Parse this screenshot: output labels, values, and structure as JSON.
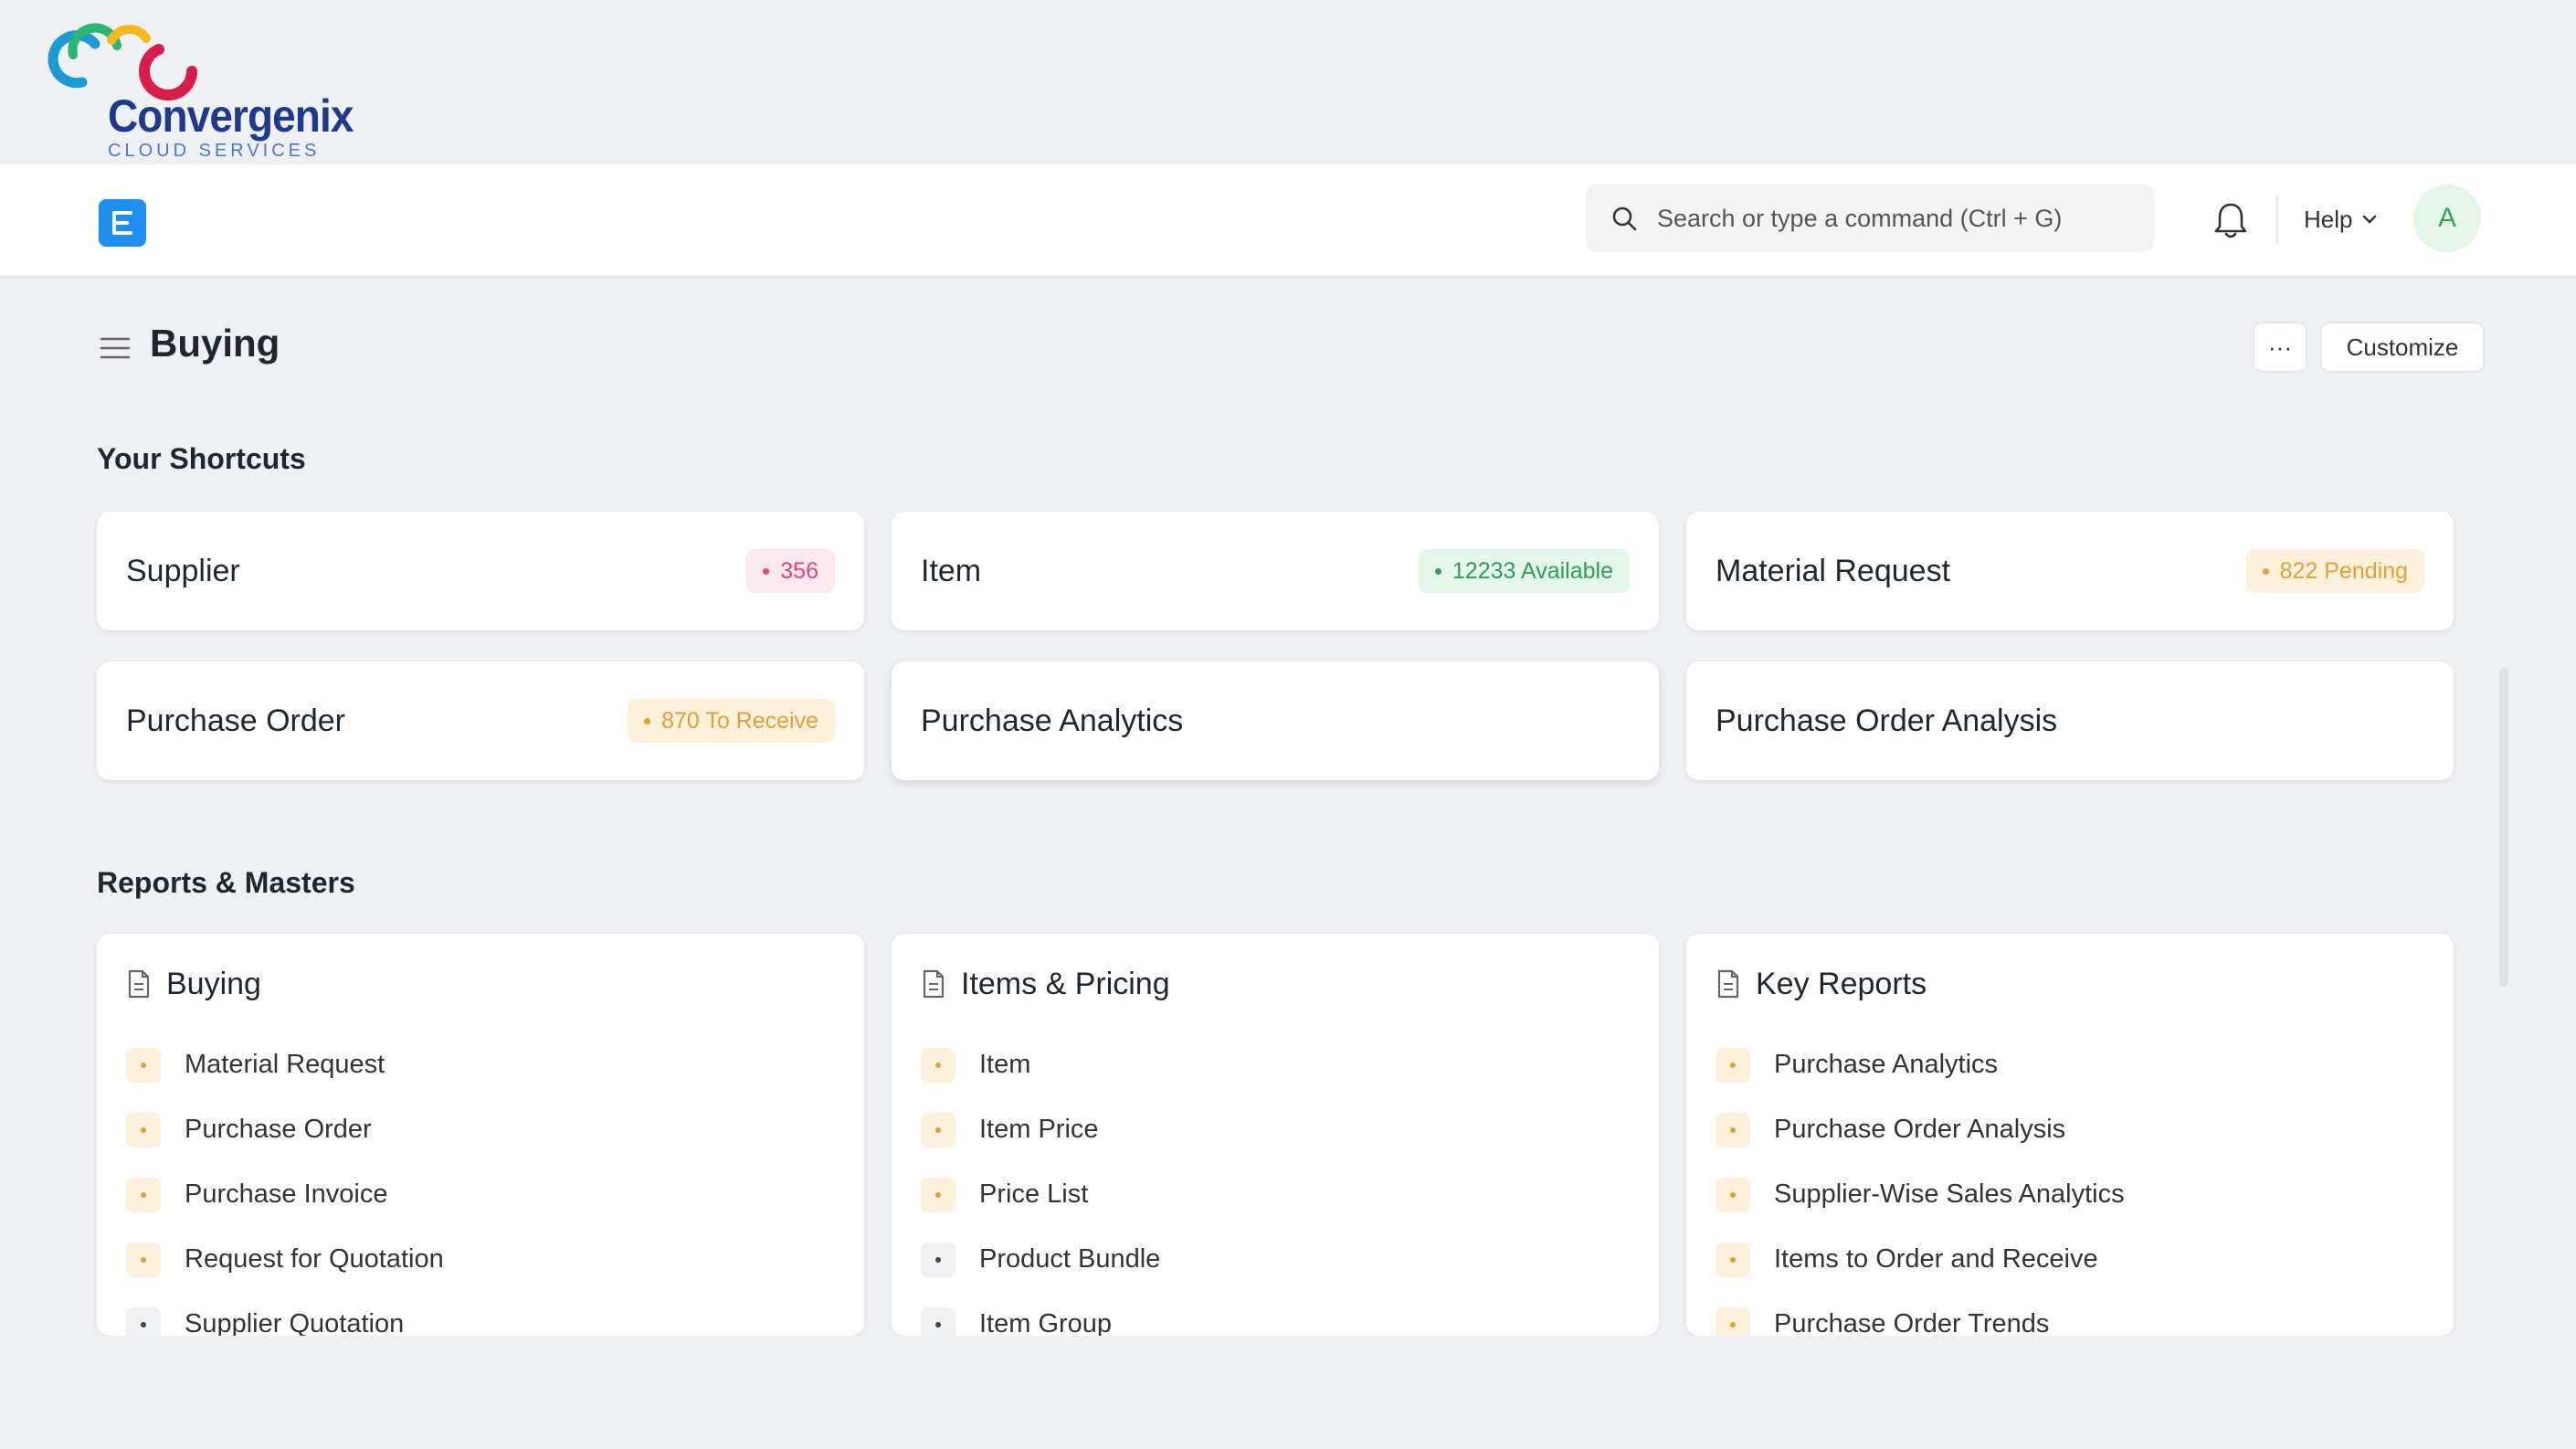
{
  "brand": {
    "name": "Convergenix",
    "tagline": "CLOUD SERVICES"
  },
  "navbar": {
    "app_logo_letter": "E",
    "search_placeholder": "Search or type a command (Ctrl + G)",
    "help_label": "Help",
    "avatar_initial": "A"
  },
  "page": {
    "title": "Buying",
    "more_label": "···",
    "customize_label": "Customize"
  },
  "shortcuts": {
    "title": "Your Shortcuts",
    "items": [
      {
        "label": "Supplier",
        "badge": "356"
      },
      {
        "label": "Item",
        "badge": "12233 Available"
      },
      {
        "label": "Material Request",
        "badge": "822 Pending"
      },
      {
        "label": "Purchase Order",
        "badge": "870 To Receive"
      },
      {
        "label": "Purchase Analytics"
      },
      {
        "label": "Purchase Order Analysis"
      }
    ]
  },
  "reports": {
    "title": "Reports & Masters",
    "cards": [
      {
        "title": "Buying",
        "items": [
          "Material Request",
          "Purchase Order",
          "Purchase Invoice",
          "Request for Quotation",
          "Supplier Quotation"
        ]
      },
      {
        "title": "Items & Pricing",
        "items": [
          "Item",
          "Item Price",
          "Price List",
          "Product Bundle",
          "Item Group"
        ]
      },
      {
        "title": "Key Reports",
        "items": [
          "Purchase Analytics",
          "Purchase Order Analysis",
          "Supplier-Wise Sales Analytics",
          "Items to Order and Receive",
          "Purchase Order Trends"
        ]
      }
    ]
  },
  "colors": {
    "pink_bg": "#fde8ef",
    "pink_fg": "#e0457b",
    "green_bg": "#e5f6ea",
    "green_fg": "#2f9e55",
    "orange_bg": "#fdf1dc",
    "orange_fg": "#e0a136",
    "gray_chip_bg": "#f0f1f3",
    "gray_chip_fg": "#444"
  }
}
